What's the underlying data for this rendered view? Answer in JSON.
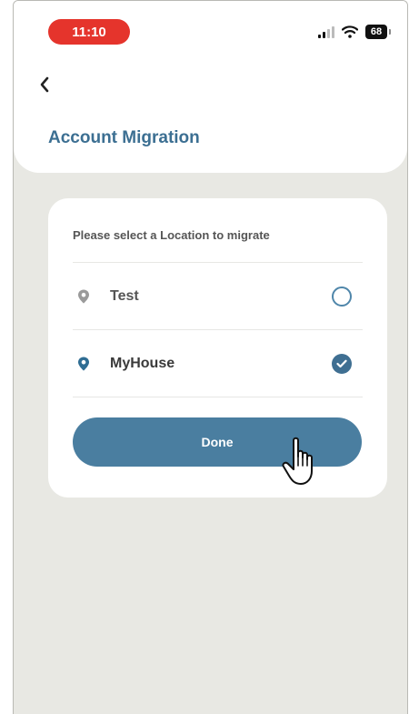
{
  "status_bar": {
    "time": "11:10",
    "battery": "68"
  },
  "header": {
    "title": "Account Migration"
  },
  "card": {
    "prompt": "Please select a Location to migrate",
    "locations": [
      {
        "label": "Test",
        "selected": false
      },
      {
        "label": "MyHouse",
        "selected": true
      }
    ],
    "done_label": "Done"
  },
  "colors": {
    "accent": "#4a7ea0",
    "title": "#3c6f92",
    "status_pill": "#e5342c",
    "background": "#e8e8e3"
  }
}
